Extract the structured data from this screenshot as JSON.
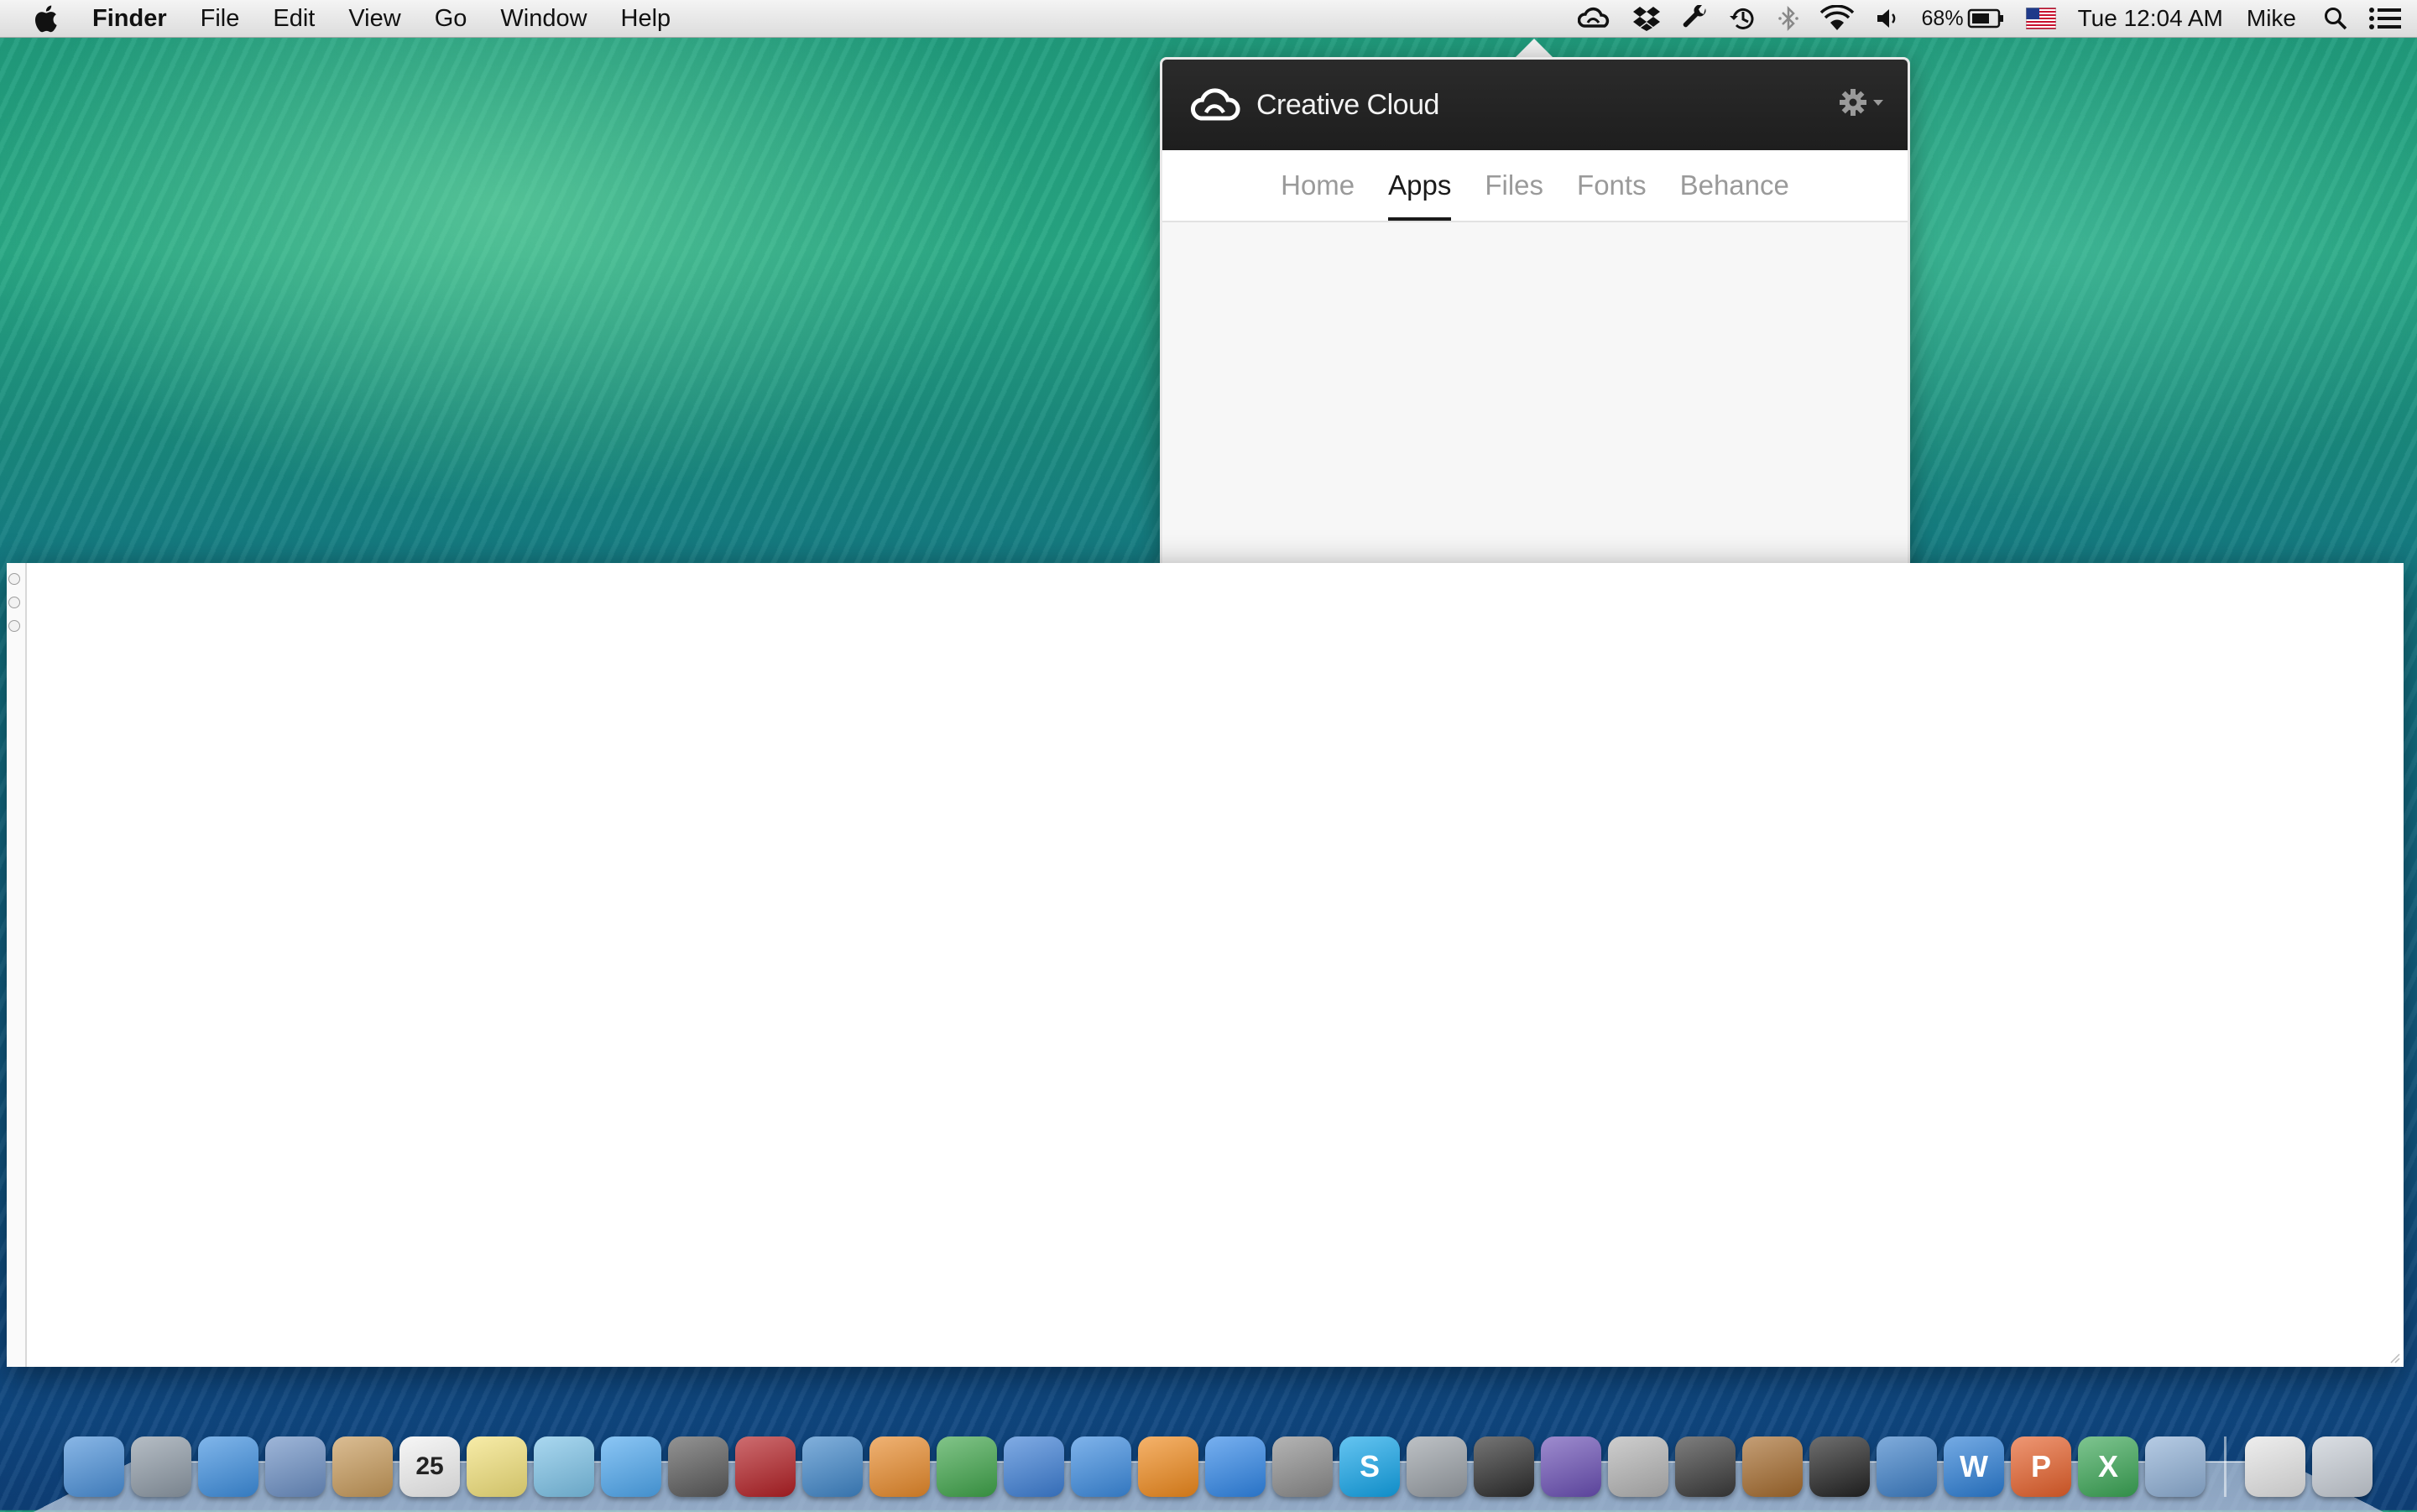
{
  "menubar": {
    "app_name": "Finder",
    "menus": [
      "File",
      "Edit",
      "View",
      "Go",
      "Window",
      "Help"
    ],
    "battery_percent": "68%",
    "clock": "Tue 12:04 AM",
    "user": "Mike"
  },
  "creative_cloud": {
    "title": "Creative Cloud",
    "tabs": [
      {
        "label": "Home",
        "active": false
      },
      {
        "label": "Apps",
        "active": true
      },
      {
        "label": "Files",
        "active": false
      },
      {
        "label": "Fonts",
        "active": false
      },
      {
        "label": "Behance",
        "active": false
      }
    ]
  },
  "dock": {
    "icons": [
      {
        "name": "finder-icon",
        "color": "#4a90d9"
      },
      {
        "name": "launchpad-icon",
        "color": "#8e9aa6"
      },
      {
        "name": "safari-icon",
        "color": "#3d8fe0"
      },
      {
        "name": "mail-bird-icon",
        "color": "#6b8fc4"
      },
      {
        "name": "contacts-icon",
        "color": "#c79a5a"
      },
      {
        "name": "calendar-icon",
        "color": "#f2f2f2",
        "text": "25"
      },
      {
        "name": "notes-icon",
        "color": "#f3e27a"
      },
      {
        "name": "maps-icon",
        "color": "#7cc3e8"
      },
      {
        "name": "messages-icon",
        "color": "#4ea8f0"
      },
      {
        "name": "facetime-icon",
        "color": "#5a5a5a"
      },
      {
        "name": "photo-booth-icon",
        "color": "#b31f24"
      },
      {
        "name": "iphoto-icon",
        "color": "#3f86c9"
      },
      {
        "name": "pages-icon",
        "color": "#e88a2a"
      },
      {
        "name": "numbers-icon",
        "color": "#3fa54a"
      },
      {
        "name": "keynote-icon",
        "color": "#3d7fd6"
      },
      {
        "name": "itunes-icon",
        "color": "#3b8be0"
      },
      {
        "name": "ibooks-icon",
        "color": "#f08a1c"
      },
      {
        "name": "app-store-icon",
        "color": "#2f86e8"
      },
      {
        "name": "system-preferences-icon",
        "color": "#8c8c8c"
      },
      {
        "name": "skype-icon",
        "color": "#12a5ea",
        "text": "S"
      },
      {
        "name": "imovie-star-icon",
        "color": "#9aa0a6"
      },
      {
        "name": "final-cut-icon",
        "color": "#2c2c2c"
      },
      {
        "name": "motion-icon",
        "color": "#6a4fb5"
      },
      {
        "name": "compressor-icon",
        "color": "#b4b4b4"
      },
      {
        "name": "logic-icon",
        "color": "#3a3a3a"
      },
      {
        "name": "instruments-icon",
        "color": "#a56b2d"
      },
      {
        "name": "aperture-icon",
        "color": "#222222"
      },
      {
        "name": "preview-icon",
        "color": "#3c7fc8"
      },
      {
        "name": "word-icon",
        "color": "#2b7ed6",
        "text": "W"
      },
      {
        "name": "powerpoint-icon",
        "color": "#e6602a",
        "text": "P"
      },
      {
        "name": "excel-icon",
        "color": "#3aa655",
        "text": "X"
      },
      {
        "name": "preview-photos-icon",
        "color": "#8fb0d6"
      }
    ],
    "stacks": [
      {
        "name": "documents-stack-icon",
        "color": "#e5e5e5"
      },
      {
        "name": "trash-icon",
        "color": "#c8ced6"
      }
    ]
  }
}
